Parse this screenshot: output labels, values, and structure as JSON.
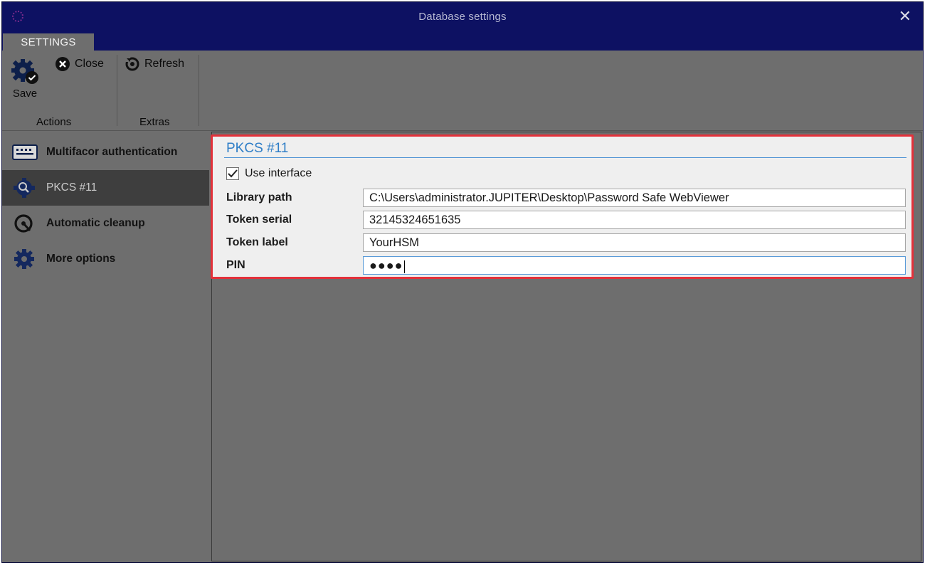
{
  "window": {
    "title": "Database settings",
    "close_glyph": "✕"
  },
  "ribbon": {
    "tab_label": "SETTINGS",
    "groups": [
      {
        "label": "Actions"
      },
      {
        "label": "Extras"
      }
    ],
    "buttons": {
      "save_label": "Save",
      "close_label": "Close",
      "refresh_label": "Refresh"
    }
  },
  "sidebar": {
    "items": [
      {
        "label": "Multifacor authentication",
        "icon": "keypad-icon",
        "active": false
      },
      {
        "label": "PKCS #11",
        "icon": "gear-search-icon",
        "active": true
      },
      {
        "label": "Automatic cleanup",
        "icon": "cleanup-icon",
        "active": false
      },
      {
        "label": "More options",
        "icon": "gear-icon",
        "active": false
      }
    ]
  },
  "panel": {
    "title": "PKCS #11",
    "use_interface": {
      "label": "Use interface",
      "checked": true
    },
    "fields": [
      {
        "label": "Library path",
        "value": "C:\\Users\\administrator.JUPITER\\Desktop\\Password Safe WebViewer"
      },
      {
        "label": "Token serial",
        "value": "32145324651635"
      },
      {
        "label": "Token label",
        "value": "YourHSM"
      },
      {
        "label": "PIN",
        "value": "●●●●"
      }
    ]
  },
  "colors": {
    "titlebar": "#0d1162",
    "highlight_border": "#e3313a",
    "panel_title": "#2f7ec7",
    "active_nav": "#3e3e3e"
  }
}
